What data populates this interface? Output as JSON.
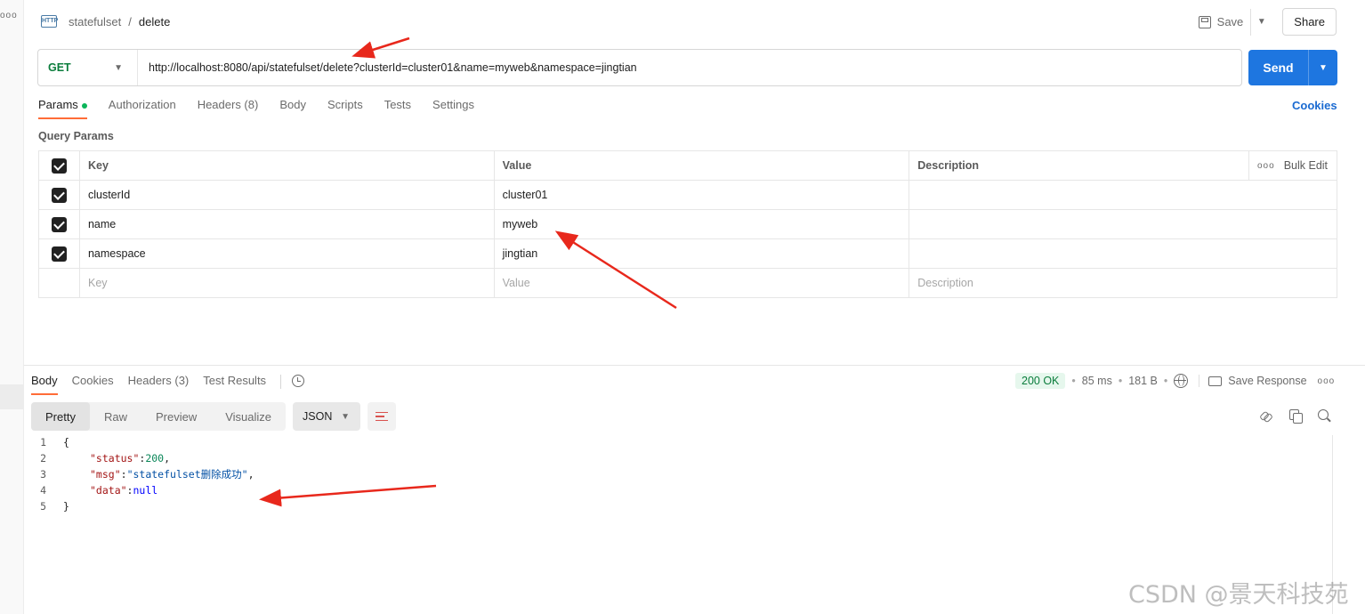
{
  "header": {
    "collection": "statefulset",
    "separator": "/",
    "request_name": "delete",
    "http_icon_text": "HTTP",
    "save_label": "Save",
    "share_label": "Share"
  },
  "request": {
    "method": "GET",
    "url": "http://localhost:8080/api/statefulset/delete?clusterId=cluster01&name=myweb&namespace=jingtian",
    "send_label": "Send"
  },
  "request_tabs": [
    {
      "label": "Params",
      "active": true,
      "has_dot": true
    },
    {
      "label": "Authorization"
    },
    {
      "label": "Headers (8)"
    },
    {
      "label": "Body"
    },
    {
      "label": "Scripts"
    },
    {
      "label": "Tests"
    },
    {
      "label": "Settings"
    }
  ],
  "cookies_link": "Cookies",
  "query_params": {
    "title": "Query Params",
    "headers": {
      "key": "Key",
      "value": "Value",
      "description": "Description",
      "bulk_edit": "Bulk Edit"
    },
    "rows": [
      {
        "checked": true,
        "key": "clusterId",
        "value": "cluster01",
        "description": ""
      },
      {
        "checked": true,
        "key": "name",
        "value": "myweb",
        "description": ""
      },
      {
        "checked": true,
        "key": "namespace",
        "value": "jingtian",
        "description": ""
      }
    ],
    "placeholders": {
      "key": "Key",
      "value": "Value",
      "description": "Description"
    }
  },
  "response_tabs": [
    {
      "label": "Body",
      "active": true
    },
    {
      "label": "Cookies"
    },
    {
      "label": "Headers (3)"
    },
    {
      "label": "Test Results"
    }
  ],
  "response_meta": {
    "status": "200 OK",
    "time": "85 ms",
    "size": "181 B",
    "save_response": "Save Response",
    "status_color": "#0b7d3c"
  },
  "format": {
    "modes": [
      "Pretty",
      "Raw",
      "Preview",
      "Visualize"
    ],
    "active": "Pretty",
    "language": "JSON"
  },
  "response_body": {
    "line_numbers": [
      "1",
      "2",
      "3",
      "4",
      "5"
    ],
    "open_brace": "{",
    "close_brace": "}",
    "status_key": "\"status\"",
    "status_value": "200",
    "msg_key": "\"msg\"",
    "msg_value": "\"statefulset删除成功\"",
    "data_key": "\"data\"",
    "data_value": "null"
  },
  "watermark": "CSDN @景天科技苑",
  "colors": {
    "accent": "#ff6c37",
    "send": "#1e76e0",
    "arrow": "#e8281c"
  }
}
